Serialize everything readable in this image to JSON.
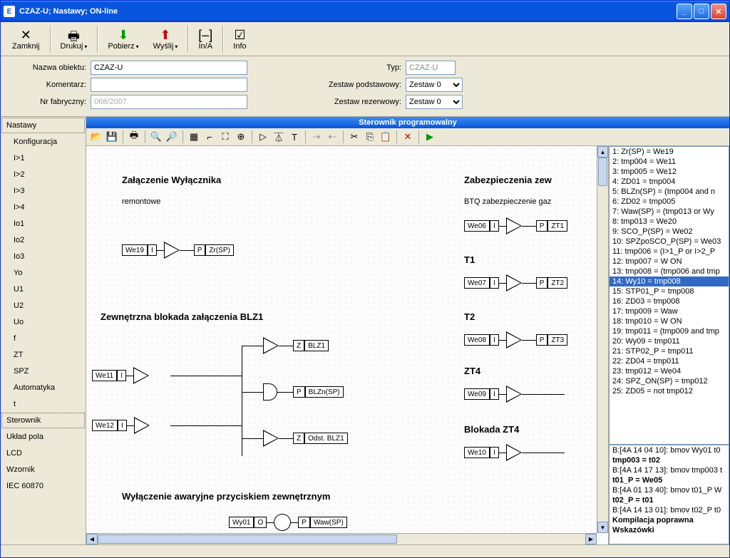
{
  "titlebar": {
    "title": "CZAZ-U; Nastawy; ON-line"
  },
  "toolbar": [
    {
      "label": "Zamknij",
      "icon": "✕"
    },
    {
      "label": "Drukuj",
      "icon": "🖶"
    },
    {
      "label": "Pobierz",
      "icon": "⬇"
    },
    {
      "label": "Wyślij",
      "icon": "⬆"
    },
    {
      "label": "In/A",
      "icon": "[–]"
    },
    {
      "label": "Info",
      "icon": "☑"
    }
  ],
  "form": {
    "labels": {
      "nazwa": "Nazwa obiektu:",
      "komentarz": "Komentarz:",
      "nr": "Nr fabryczny:",
      "typ": "Typ:",
      "zp": "Zestaw podstawowy:",
      "zr": "Zestaw rezerwowy:"
    },
    "values": {
      "nazwa": "CZAZ-U",
      "komentarz": "",
      "nr": "068/2007",
      "typ": "CZAZ-U",
      "zp": "Zestaw 0",
      "zr": "Zestaw 0"
    }
  },
  "sidebar": {
    "head": "Nastawy",
    "items": [
      "Konfiguracja",
      "I>1",
      "I>2",
      "I>3",
      "I>4",
      "Io1",
      "Io2",
      "Io3",
      "Yo",
      "U1",
      "U2",
      "Uo",
      "f",
      "ZT",
      "SPZ",
      "Automatyka",
      "t"
    ],
    "cats": [
      "Sterownik",
      "Układ pola",
      "LCD",
      "Wzornik",
      "IEC 60870"
    ],
    "selected_cat": 0
  },
  "panel_title": "Sterownik programowalny",
  "diagram": {
    "t1": "Załączenie Wyłącznika",
    "t1s": "remontowe",
    "t2": "Zewnętrzna blokada załączenia BLZ1",
    "t3": "Wyłączenie awaryjne przyciskiem zewnętrznym",
    "t4": "Zabezpieczenia zew",
    "t4s": "BTQ zabezpieczenie gaz",
    "t5": "T1",
    "t6": "T2",
    "t7": "ZT4",
    "t8": "Blokada ZT4",
    "boxes": {
      "we19": "We19",
      "we11": "We11",
      "we12": "We12",
      "we06": "We06",
      "we07": "We07",
      "we08": "We08",
      "we09": "We09",
      "we10": "We10",
      "wy01": "Wy01",
      "zrsp": "Zr(SP)",
      "blz1": "BLZ1",
      "blznsp": "BLZn(SP)",
      "odstblz1": "Odst. BLZ1",
      "wawsp": "Waw(SP)",
      "zt1": "ZT1",
      "zt2": "ZT2",
      "zt3": "ZT3",
      "I": "I",
      "O": "O",
      "P": "P",
      "Z": "Z"
    }
  },
  "code": [
    "1: Zr(SP) = We19",
    "2: tmp004 = We11",
    "3: tmp005 = We12",
    "4: ZD01 = tmp004",
    "5: BLZn(SP) =  (tmp004 and n",
    "6: ZD02 = tmp005",
    "7: Waw(SP) =  (tmp013 or Wy",
    "8: tmp013 = We20",
    "9: SCO_P(SP) = We02",
    "10: SPZpoSCO_P(SP) = We03",
    "11: tmp006 =  (I>1_P or I>2_P",
    "12: tmp007 = W ON",
    "13: tmp008 =  (tmp006 and tmp",
    "14: Wy10 = tmp008",
    "15: STP01_P = tmp008",
    "16: ZD03 = tmp008",
    "17: tmp009 = Waw",
    "18: tmp010 = W ON",
    "19: tmp011 =  (tmp009 and tmp",
    "20: Wy09 = tmp011",
    "21: STP02_P = tmp011",
    "22: ZD04 = tmp011",
    "23: tmp012 = We04",
    "24: SPZ_ON(SP) = tmp012",
    "25: ZD05 = not tmp012"
  ],
  "code_selected": 13,
  "log": [
    {
      "t": "B:[4A 14 04 10]: bmov Wy01 t0",
      "b": false
    },
    {
      "t": "tmp003 = t02",
      "b": true
    },
    {
      "t": "B:[4A 14 17 13]: bmov tmp003 t",
      "b": false
    },
    {
      "t": "t01_P = We05",
      "b": true
    },
    {
      "t": "B:[4A 01 13 40]: bmov t01_P W",
      "b": false
    },
    {
      "t": "t02_P = t01",
      "b": true
    },
    {
      "t": "B:[4A 14 13 01]: bmov t02_P t0",
      "b": false
    },
    {
      "t": "Kompilacja poprawna",
      "b": true
    },
    {
      "t": "Wskazówki",
      "b": true
    }
  ]
}
